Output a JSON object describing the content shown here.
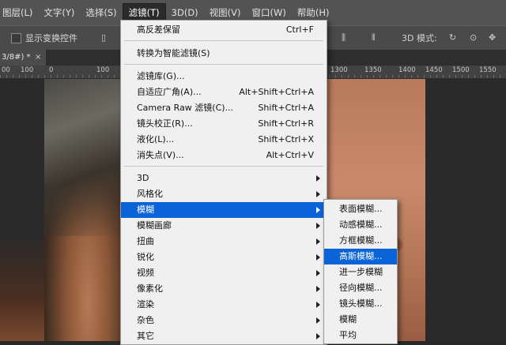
{
  "menubar": {
    "items": [
      {
        "label": "图层(L)"
      },
      {
        "label": "文字(Y)"
      },
      {
        "label": "选择(S)"
      },
      {
        "label": "滤镜(T)"
      },
      {
        "label": "3D(D)"
      },
      {
        "label": "视图(V)"
      },
      {
        "label": "窗口(W)"
      },
      {
        "label": "帮助(H)"
      }
    ]
  },
  "optionsbar": {
    "show_transform_label": "显示变换控件",
    "mode_label": "3D 模式:"
  },
  "document": {
    "tab_label": "3/8#) *",
    "close_glyph": "×"
  },
  "ruler": {
    "ticks": [
      "00",
      "100",
      "0",
      "100",
      "1300",
      "1350",
      "1400",
      "1450",
      "1500",
      "1550",
      "1600",
      "1700",
      "1750"
    ]
  },
  "filter_menu": {
    "items": [
      {
        "label": "高反差保留",
        "shortcut": "Ctrl+F"
      },
      {
        "label": "转换为智能滤镜(S)",
        "shortcut": ""
      },
      {
        "label": "滤镜库(G)...",
        "shortcut": ""
      },
      {
        "label": "自适应广角(A)...",
        "shortcut": "Alt+Shift+Ctrl+A"
      },
      {
        "label": "Camera Raw 滤镜(C)...",
        "shortcut": "Shift+Ctrl+A"
      },
      {
        "label": "镜头校正(R)...",
        "shortcut": "Shift+Ctrl+R"
      },
      {
        "label": "液化(L)...",
        "shortcut": "Shift+Ctrl+X"
      },
      {
        "label": "消失点(V)...",
        "shortcut": "Alt+Ctrl+V"
      },
      {
        "label": "3D",
        "shortcut": ""
      },
      {
        "label": "风格化",
        "shortcut": ""
      },
      {
        "label": "模糊",
        "shortcut": ""
      },
      {
        "label": "模糊画廊",
        "shortcut": ""
      },
      {
        "label": "扭曲",
        "shortcut": ""
      },
      {
        "label": "锐化",
        "shortcut": ""
      },
      {
        "label": "视频",
        "shortcut": ""
      },
      {
        "label": "像素化",
        "shortcut": ""
      },
      {
        "label": "渲染",
        "shortcut": ""
      },
      {
        "label": "杂色",
        "shortcut": ""
      },
      {
        "label": "其它",
        "shortcut": ""
      }
    ]
  },
  "blur_submenu": {
    "items": [
      {
        "label": "表面模糊..."
      },
      {
        "label": "动感模糊..."
      },
      {
        "label": "方框模糊..."
      },
      {
        "label": "高斯模糊..."
      },
      {
        "label": "进一步模糊"
      },
      {
        "label": "径向模糊..."
      },
      {
        "label": "镜头模糊..."
      },
      {
        "label": "模糊"
      },
      {
        "label": "平均"
      }
    ]
  },
  "colors": {
    "highlight": "#0a64d8",
    "menu_bg": "#f0f0f0",
    "menubar_bg": "#535353"
  }
}
